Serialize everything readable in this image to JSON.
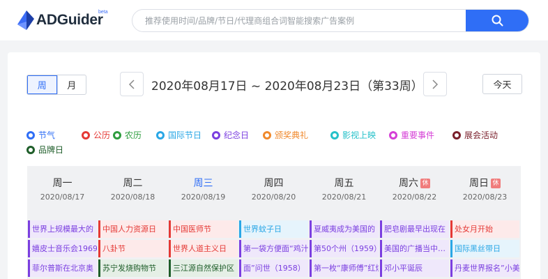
{
  "header": {
    "logo_text": "ADGuider",
    "logo_beta": "beta",
    "search_placeholder": "推荐使用时间/品牌/节日/代理商组合词智能搜索广告案例",
    "search_icon": "search-icon"
  },
  "toolbar": {
    "view_week": "周",
    "view_month": "月",
    "week_range": "2020年08月17日 ~ 2020年08月23日（第33周）",
    "today": "今天",
    "prev_icon": "chevron-left-icon",
    "next_icon": "chevron-right-icon"
  },
  "legend": [
    {
      "label": "节气",
      "color": "#2f6ef6"
    },
    {
      "label": "公历",
      "color": "#e53935"
    },
    {
      "label": "农历",
      "color": "#2e9d3f"
    },
    {
      "label": "国际节日",
      "color": "#2aa7e6"
    },
    {
      "label": "纪念日",
      "color": "#7b3fe0"
    },
    {
      "label": "颁奖典礼",
      "color": "#f0892c"
    },
    {
      "label": "影视上映",
      "color": "#26c1c9"
    },
    {
      "label": "重要事件",
      "color": "#d53fd6"
    },
    {
      "label": "展会活动",
      "color": "#7a1f2b"
    },
    {
      "label": "品牌日",
      "color": "#1f5e2a"
    }
  ],
  "days": [
    {
      "name": "周一",
      "date": "2020/08/17",
      "current": false,
      "rest": "",
      "events": [
        {
          "text": "世界上规模最大的",
          "color": "#7b3fe0",
          "bg": "#efe8fb"
        },
        {
          "text": "嬉皮士音乐会1969",
          "color": "#7b3fe0",
          "bg": "#efe8fb"
        },
        {
          "text": "菲尔普斯在北京奥",
          "color": "#7b3fe0",
          "bg": "#efe8fb"
        }
      ]
    },
    {
      "name": "周二",
      "date": "2020/08/18",
      "current": false,
      "rest": "",
      "events": [
        {
          "text": "中国人力资源日",
          "color": "#e53935",
          "bg": "#fdeaea"
        },
        {
          "text": "八卦节",
          "color": "#e53935",
          "bg": "#fdeaea"
        },
        {
          "text": "苏宁发烧购物节",
          "color": "#1f5e2a",
          "bg": "#e5efe6"
        }
      ]
    },
    {
      "name": "周三",
      "date": "2020/08/19",
      "current": true,
      "rest": "",
      "events": [
        {
          "text": "中国医师节",
          "color": "#e53935",
          "bg": "#fdeaea"
        },
        {
          "text": "世界人道主义日",
          "color": "#e53935",
          "bg": "#fdeaea"
        },
        {
          "text": "三江源自然保护区",
          "color": "#1f5e2a",
          "bg": "#e5efe6"
        }
      ]
    },
    {
      "name": "周四",
      "date": "2020/08/20",
      "current": false,
      "rest": "",
      "events": [
        {
          "text": "世界蚊子日",
          "color": "#2aa7e6",
          "bg": "#e6f4fc"
        },
        {
          "text": "第一袋方便面“鸡汁",
          "color": "#7b3fe0",
          "bg": "#efe8fb"
        },
        {
          "text": "面”问世（1958）",
          "color": "#7b3fe0",
          "bg": "#efe8fb"
        }
      ]
    },
    {
      "name": "周五",
      "date": "2020/08/21",
      "current": false,
      "rest": "",
      "events": [
        {
          "text": "夏威夷成为美国的",
          "color": "#7b3fe0",
          "bg": "#efe8fb"
        },
        {
          "text": "第50个州（1959）",
          "color": "#7b3fe0",
          "bg": "#efe8fb"
        },
        {
          "text": "第一枚“康师傅”红烧",
          "color": "#7b3fe0",
          "bg": "#efe8fb"
        }
      ]
    },
    {
      "name": "周六",
      "date": "2020/08/22",
      "current": false,
      "rest": "休",
      "events": [
        {
          "text": "肥皂剧最早出现在",
          "color": "#7b3fe0",
          "bg": "#efe8fb"
        },
        {
          "text": "美国的广播当中…",
          "color": "#7b3fe0",
          "bg": "#efe8fb"
        },
        {
          "text": "邓小平诞辰",
          "color": "#7b3fe0",
          "bg": "#efe8fb"
        }
      ]
    },
    {
      "name": "周日",
      "date": "2020/08/23",
      "current": false,
      "rest": "休",
      "events": [
        {
          "text": "处女月开始",
          "color": "#e53935",
          "bg": "#fdeaea"
        },
        {
          "text": "国际黑丝带日",
          "color": "#2aa7e6",
          "bg": "#e6f4fc"
        },
        {
          "text": "丹麦世界报名”小美",
          "color": "#7b3fe0",
          "bg": "#efe8fb"
        }
      ]
    }
  ]
}
